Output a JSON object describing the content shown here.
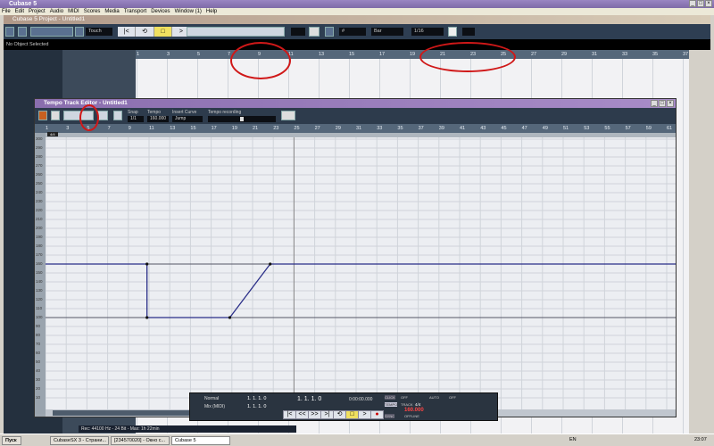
{
  "app_title": "Cubase 5",
  "menu": [
    "File",
    "Edit",
    "Project",
    "Audio",
    "MIDI",
    "Scores",
    "Media",
    "Transport",
    "Devices",
    "Window (1)",
    "Help"
  ],
  "project_title": "Cubase 5 Project - Untitled1",
  "toolbar": {
    "automation_mode": "Touch",
    "grid_type": "Bar",
    "quantize": "1/16"
  },
  "info_line": "No Object Selected",
  "main_ruler": [
    "1",
    "3",
    "5",
    "7",
    "9",
    "11",
    "13",
    "15",
    "17",
    "19",
    "21",
    "23",
    "25",
    "27",
    "29",
    "31",
    "33",
    "35",
    "37"
  ],
  "tempo_editor": {
    "title": "Tempo Track Editor - Untitled1",
    "snap_label": "Snap",
    "snap_value": "1/1",
    "tempo_label": "Tempo",
    "tempo_value": "160.000",
    "insert_curve_label": "Insert Curve",
    "insert_curve_value": "Jump",
    "recording_label": "Tempo recording",
    "signature_marker": "4/4",
    "ruler": [
      "1",
      "3",
      "5",
      "7",
      "9",
      "11",
      "13",
      "15",
      "17",
      "19",
      "21",
      "23",
      "25",
      "27",
      "29",
      "31",
      "33",
      "35",
      "37",
      "39",
      "41",
      "43",
      "45",
      "47",
      "49",
      "51",
      "53",
      "55",
      "57",
      "59",
      "61"
    ],
    "y_ticks": [
      "300",
      "290",
      "280",
      "270",
      "260",
      "250",
      "240",
      "230",
      "220",
      "210",
      "200",
      "190",
      "180",
      "170",
      "160",
      "150",
      "140",
      "130",
      "120",
      "110",
      "100",
      "90",
      "80",
      "70",
      "60",
      "50",
      "40",
      "30",
      "20",
      "10"
    ],
    "tempo_points": [
      {
        "bar": 1,
        "bpm": 160
      },
      {
        "bar": 10.8,
        "bpm": 160
      },
      {
        "bar": 10.8,
        "bpm": 100
      },
      {
        "bar": 18.8,
        "bpm": 100
      },
      {
        "bar": 22.7,
        "bpm": 160
      },
      {
        "bar": 62,
        "bpm": 160
      }
    ],
    "cursor_bar": 25,
    "line_color": "#2a2e88"
  },
  "transport": {
    "mode": "Normal",
    "mix": "Mix (MIDI)",
    "left_locator": "1. 1. 1.   0",
    "right_locator": "1. 1. 1.   0",
    "position": "1. 1. 1.   0",
    "time": "0:00:00.000",
    "click": "CLICK",
    "click_state": "OFF",
    "tempo_btn": "TEMPO",
    "track": "TRACK",
    "signature": "4/4",
    "tempo": "160.000",
    "sync": "SYNC",
    "sync_state": "OFFLINE",
    "auto": "AUTO",
    "auto_state": "OFF",
    "buttons": [
      "|<",
      "<<",
      ">>",
      ">|",
      "⟲",
      "□",
      ">",
      "●"
    ]
  },
  "status": "Rec: 44100 Hz - 24 Bit - Max: 1h 22min",
  "taskbar": {
    "start": "Пуск",
    "tasks": [
      "CubaseSX 3 - Страни...",
      "[234570020] - Окно с...",
      "Cubase 5"
    ],
    "lang": "EN",
    "clock": "23:07"
  }
}
